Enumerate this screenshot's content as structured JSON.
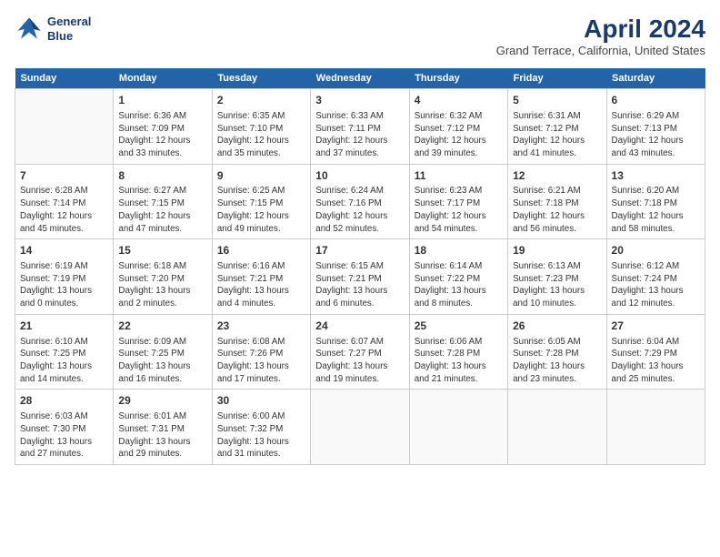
{
  "header": {
    "logo_line1": "General",
    "logo_line2": "Blue",
    "month_year": "April 2024",
    "location": "Grand Terrace, California, United States"
  },
  "weekdays": [
    "Sunday",
    "Monday",
    "Tuesday",
    "Wednesday",
    "Thursday",
    "Friday",
    "Saturday"
  ],
  "weeks": [
    [
      {
        "num": "",
        "detail": ""
      },
      {
        "num": "1",
        "detail": "Sunrise: 6:36 AM\nSunset: 7:09 PM\nDaylight: 12 hours\nand 33 minutes."
      },
      {
        "num": "2",
        "detail": "Sunrise: 6:35 AM\nSunset: 7:10 PM\nDaylight: 12 hours\nand 35 minutes."
      },
      {
        "num": "3",
        "detail": "Sunrise: 6:33 AM\nSunset: 7:11 PM\nDaylight: 12 hours\nand 37 minutes."
      },
      {
        "num": "4",
        "detail": "Sunrise: 6:32 AM\nSunset: 7:12 PM\nDaylight: 12 hours\nand 39 minutes."
      },
      {
        "num": "5",
        "detail": "Sunrise: 6:31 AM\nSunset: 7:12 PM\nDaylight: 12 hours\nand 41 minutes."
      },
      {
        "num": "6",
        "detail": "Sunrise: 6:29 AM\nSunset: 7:13 PM\nDaylight: 12 hours\nand 43 minutes."
      }
    ],
    [
      {
        "num": "7",
        "detail": "Sunrise: 6:28 AM\nSunset: 7:14 PM\nDaylight: 12 hours\nand 45 minutes."
      },
      {
        "num": "8",
        "detail": "Sunrise: 6:27 AM\nSunset: 7:15 PM\nDaylight: 12 hours\nand 47 minutes."
      },
      {
        "num": "9",
        "detail": "Sunrise: 6:25 AM\nSunset: 7:15 PM\nDaylight: 12 hours\nand 49 minutes."
      },
      {
        "num": "10",
        "detail": "Sunrise: 6:24 AM\nSunset: 7:16 PM\nDaylight: 12 hours\nand 52 minutes."
      },
      {
        "num": "11",
        "detail": "Sunrise: 6:23 AM\nSunset: 7:17 PM\nDaylight: 12 hours\nand 54 minutes."
      },
      {
        "num": "12",
        "detail": "Sunrise: 6:21 AM\nSunset: 7:18 PM\nDaylight: 12 hours\nand 56 minutes."
      },
      {
        "num": "13",
        "detail": "Sunrise: 6:20 AM\nSunset: 7:18 PM\nDaylight: 12 hours\nand 58 minutes."
      }
    ],
    [
      {
        "num": "14",
        "detail": "Sunrise: 6:19 AM\nSunset: 7:19 PM\nDaylight: 13 hours\nand 0 minutes."
      },
      {
        "num": "15",
        "detail": "Sunrise: 6:18 AM\nSunset: 7:20 PM\nDaylight: 13 hours\nand 2 minutes."
      },
      {
        "num": "16",
        "detail": "Sunrise: 6:16 AM\nSunset: 7:21 PM\nDaylight: 13 hours\nand 4 minutes."
      },
      {
        "num": "17",
        "detail": "Sunrise: 6:15 AM\nSunset: 7:21 PM\nDaylight: 13 hours\nand 6 minutes."
      },
      {
        "num": "18",
        "detail": "Sunrise: 6:14 AM\nSunset: 7:22 PM\nDaylight: 13 hours\nand 8 minutes."
      },
      {
        "num": "19",
        "detail": "Sunrise: 6:13 AM\nSunset: 7:23 PM\nDaylight: 13 hours\nand 10 minutes."
      },
      {
        "num": "20",
        "detail": "Sunrise: 6:12 AM\nSunset: 7:24 PM\nDaylight: 13 hours\nand 12 minutes."
      }
    ],
    [
      {
        "num": "21",
        "detail": "Sunrise: 6:10 AM\nSunset: 7:25 PM\nDaylight: 13 hours\nand 14 minutes."
      },
      {
        "num": "22",
        "detail": "Sunrise: 6:09 AM\nSunset: 7:25 PM\nDaylight: 13 hours\nand 16 minutes."
      },
      {
        "num": "23",
        "detail": "Sunrise: 6:08 AM\nSunset: 7:26 PM\nDaylight: 13 hours\nand 17 minutes."
      },
      {
        "num": "24",
        "detail": "Sunrise: 6:07 AM\nSunset: 7:27 PM\nDaylight: 13 hours\nand 19 minutes."
      },
      {
        "num": "25",
        "detail": "Sunrise: 6:06 AM\nSunset: 7:28 PM\nDaylight: 13 hours\nand 21 minutes."
      },
      {
        "num": "26",
        "detail": "Sunrise: 6:05 AM\nSunset: 7:28 PM\nDaylight: 13 hours\nand 23 minutes."
      },
      {
        "num": "27",
        "detail": "Sunrise: 6:04 AM\nSunset: 7:29 PM\nDaylight: 13 hours\nand 25 minutes."
      }
    ],
    [
      {
        "num": "28",
        "detail": "Sunrise: 6:03 AM\nSunset: 7:30 PM\nDaylight: 13 hours\nand 27 minutes."
      },
      {
        "num": "29",
        "detail": "Sunrise: 6:01 AM\nSunset: 7:31 PM\nDaylight: 13 hours\nand 29 minutes."
      },
      {
        "num": "30",
        "detail": "Sunrise: 6:00 AM\nSunset: 7:32 PM\nDaylight: 13 hours\nand 31 minutes."
      },
      {
        "num": "",
        "detail": ""
      },
      {
        "num": "",
        "detail": ""
      },
      {
        "num": "",
        "detail": ""
      },
      {
        "num": "",
        "detail": ""
      }
    ]
  ]
}
